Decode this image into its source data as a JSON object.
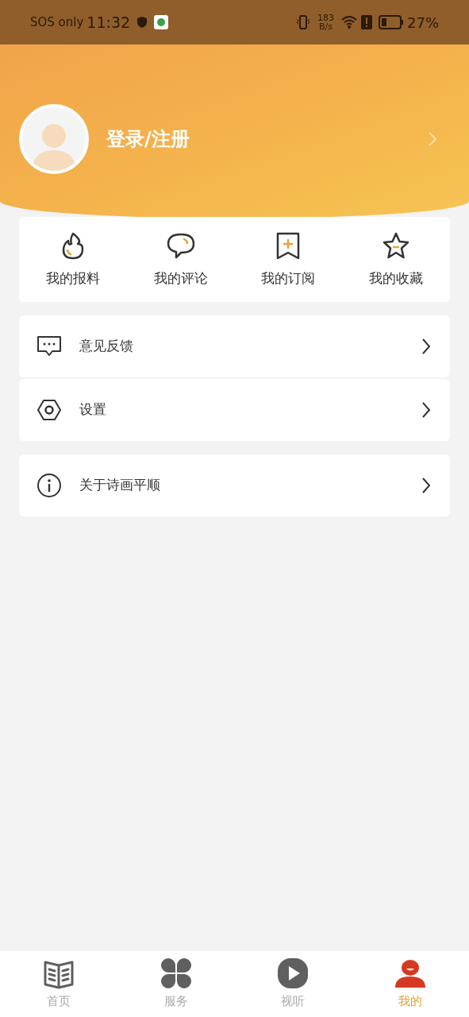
{
  "status_bar": {
    "carrier": "SOS only",
    "time": "11:32",
    "speed_value": "183",
    "speed_unit": "B/s",
    "battery": "27%"
  },
  "profile": {
    "login_label": "登录/注册"
  },
  "shortcuts": [
    {
      "kind": "flame",
      "label": "我的报料"
    },
    {
      "kind": "comment",
      "label": "我的评论"
    },
    {
      "kind": "bookmark",
      "label": "我的订阅"
    },
    {
      "kind": "star",
      "label": "我的收藏"
    }
  ],
  "menu_groups": [
    [
      {
        "kind": "feedback",
        "label": "意见反馈"
      },
      {
        "kind": "settings",
        "label": "设置"
      }
    ],
    [
      {
        "kind": "info",
        "label": "关于诗画平顺"
      }
    ]
  ],
  "tab_bar": [
    {
      "kind": "news",
      "label": "首页",
      "selected": false
    },
    {
      "kind": "services",
      "label": "服务",
      "selected": false
    },
    {
      "kind": "video",
      "label": "视听",
      "selected": false
    },
    {
      "kind": "me",
      "label": "我的",
      "selected": true
    }
  ]
}
